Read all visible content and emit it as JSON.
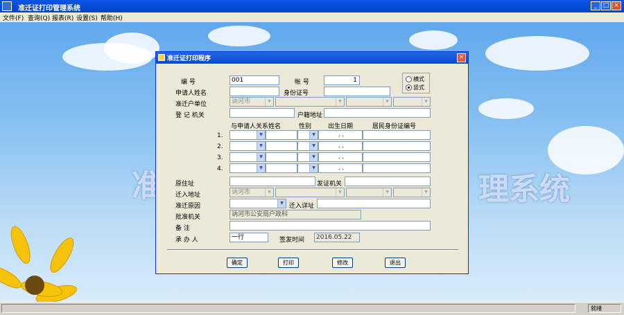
{
  "app": {
    "title": "准迁证打印管理系统"
  },
  "menu": [
    "文件(F)",
    "查询(Q)",
    "报表(R)",
    "设置(S)",
    "帮助(H)"
  ],
  "desktop": {
    "bg_text_left": "准",
    "bg_text_right": "理系统"
  },
  "dialog": {
    "title": "准迁证打印程序",
    "labels": {
      "serial": "编    号",
      "applicant": "申请人姓名",
      "id_no": "身份证号",
      "register_unit": "准迁户单位",
      "register_no": "登 记 机关",
      "address": "户籍地址",
      "col_relation": "与申请人关系",
      "col_name": "姓名",
      "col_sex": "性别",
      "col_birth": "出生日期",
      "col_id": "居民身份证编号",
      "old_addr": "原住址",
      "issue_place": "发证机关",
      "move_in_addr": "迁入地址",
      "reason": "准迁原因",
      "detail_addr": "迁入详址",
      "approve_org": "批准机关",
      "remark": "备    注",
      "handler": "承 办 人",
      "issue_date": "签发时间"
    },
    "fields": {
      "serial_value": "001",
      "account_value": "1",
      "register_unit_value": "讷河市",
      "move_in_value": "讷河市",
      "approve_org_value": "讷河市公安局户政科",
      "handler_value": "一行",
      "issue_date_value": "2016.05.22"
    },
    "row_numbers": [
      "1.",
      "2.",
      "3.",
      "4."
    ],
    "date_dots": ". .",
    "radio": {
      "opt1": "横式",
      "opt2": "竖式"
    },
    "buttons": {
      "confirm": "确定",
      "print": "打印",
      "modify": "修改",
      "exit": "退出"
    }
  },
  "status": {
    "right_text": "就绪"
  }
}
